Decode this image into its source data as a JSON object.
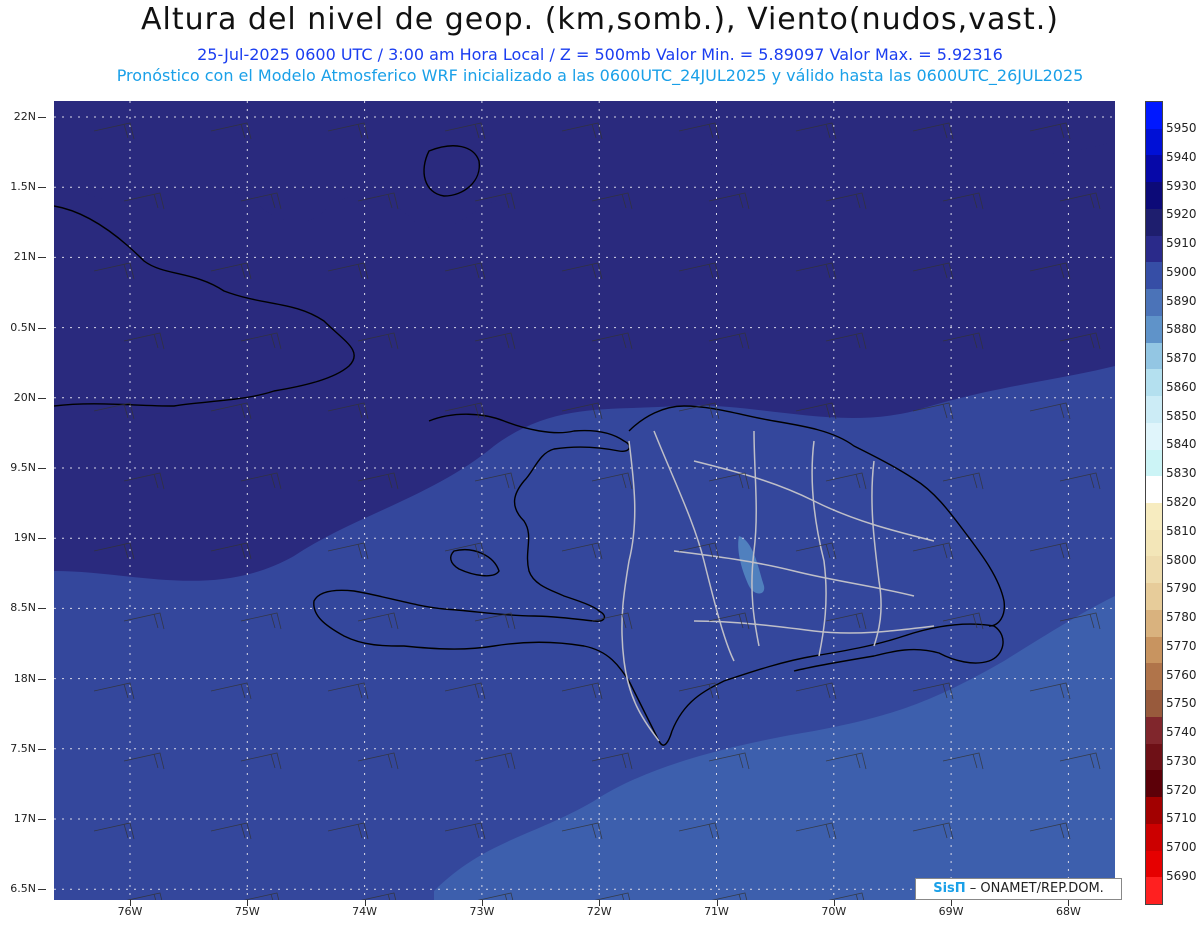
{
  "header": {
    "title": "Altura del nivel de geop. (km,somb.), Viento(nudos,vast.)",
    "subtitle1": "25-Jul-2025   0600 UTC / 3:00 am Hora Local / Z = 500mb     Valor Min. = 5.89097  Valor Max. = 5.92316",
    "subtitle2": "Pronóstico con el Modelo Atmosferico WRF inicializado a las 0600UTC_24JUL2025 y válido hasta las  0600UTC_26JUL2025"
  },
  "map": {
    "lat_labels": [
      "22N",
      "1.5N",
      "21N",
      "0.5N",
      "20N",
      "9.5N",
      "19N",
      "8.5N",
      "18N",
      "7.5N",
      "17N",
      "6.5N"
    ],
    "lon_labels": [
      "76W",
      "75W",
      "74W",
      "73W",
      "72W",
      "71W",
      "70W",
      "69W",
      "68W"
    ],
    "shade_colors": {
      "c5910": "#2a2a7e",
      "c5900": "#34479c",
      "c5890": "#3d5fad",
      "c5880": "#5080be"
    }
  },
  "colorbar": {
    "levels": [
      "5950",
      "5940",
      "5930",
      "5920",
      "5910",
      "5900",
      "5890",
      "5880",
      "5870",
      "5860",
      "5850",
      "5840",
      "5830",
      "5820",
      "5810",
      "5800",
      "5790",
      "5780",
      "5770",
      "5760",
      "5750",
      "5740",
      "5730",
      "5720",
      "5710",
      "5700",
      "5690"
    ],
    "colors": [
      "#0018ff",
      "#0010d6",
      "#0608a8",
      "#0c0a78",
      "#1e1e6e",
      "#2a2a8a",
      "#364ea6",
      "#4b73b8",
      "#5f93c9",
      "#93c6e3",
      "#b4e0ef",
      "#ccecf6",
      "#e0f5fb",
      "#ccf4f6",
      "#ffffff",
      "#f7ecc0",
      "#f3e6b8",
      "#eedcae",
      "#e7cc9a",
      "#d9b27e",
      "#c89460",
      "#b0744a",
      "#985a3c",
      "#80262c",
      "#6e1016",
      "#5c0008",
      "#a20000",
      "#cc0000",
      "#e60000",
      "#ff2020"
    ]
  },
  "credit": {
    "brand": "SisΠ",
    "text": " – ONAMET/REP.DOM."
  }
}
